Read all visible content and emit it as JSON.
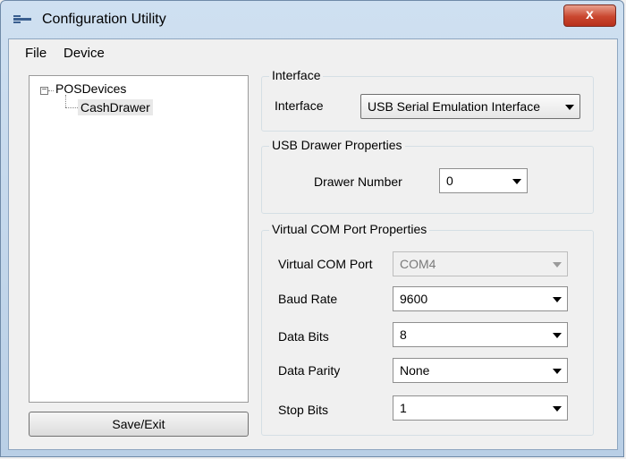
{
  "window": {
    "title": "Configuration Utility",
    "close_glyph": "x"
  },
  "menu": {
    "file": "File",
    "device": "Device"
  },
  "tree": {
    "expander_glyph": "−",
    "root": "POSDevices",
    "child": "CashDrawer"
  },
  "buttons": {
    "save_exit": "Save/Exit"
  },
  "interface_group": {
    "title": "Interface",
    "label": "Interface",
    "value": "USB Serial Emulation Interface"
  },
  "usb_group": {
    "title": "USB Drawer Properties",
    "drawer_number_label": "Drawer Number",
    "drawer_number_value": "0"
  },
  "com_group": {
    "title": "Virtual COM Port Properties",
    "virtual_com_port": {
      "label": "Virtual COM Port",
      "value": "COM4",
      "enabled": false
    },
    "baud_rate": {
      "label": "Baud Rate",
      "value": "9600"
    },
    "data_bits": {
      "label": "Data Bits",
      "value": "8"
    },
    "data_parity": {
      "label": "Data Parity",
      "value": "None"
    },
    "stop_bits": {
      "label": "Stop Bits",
      "value": "1"
    }
  },
  "icons": {
    "app": "app-icon",
    "close": "close-icon",
    "dropdown": "chevron-down-icon"
  }
}
